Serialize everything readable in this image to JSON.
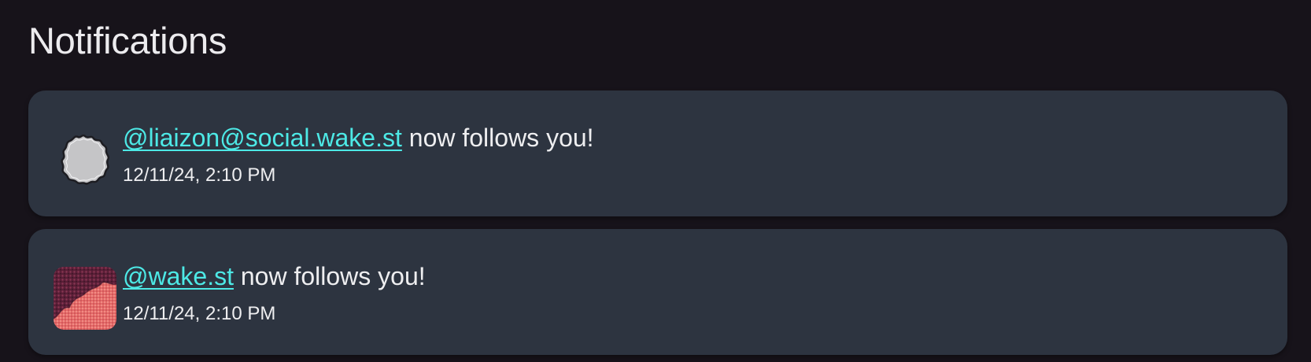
{
  "page": {
    "title": "Notifications"
  },
  "notifications": [
    {
      "handle": "@liaizon@social.wake.st",
      "message": "now follows you!",
      "timestamp": "12/11/24, 2:10 PM",
      "avatar_icon": "gray-blob-avatar"
    },
    {
      "handle": "@wake.st",
      "message": "now follows you!",
      "timestamp": "12/11/24, 2:10 PM",
      "avatar_icon": "pink-texture-avatar"
    }
  ],
  "colors": {
    "background": "#17131a",
    "card": "#2d3440",
    "link": "#4de9e6",
    "text": "#eeeef0"
  }
}
